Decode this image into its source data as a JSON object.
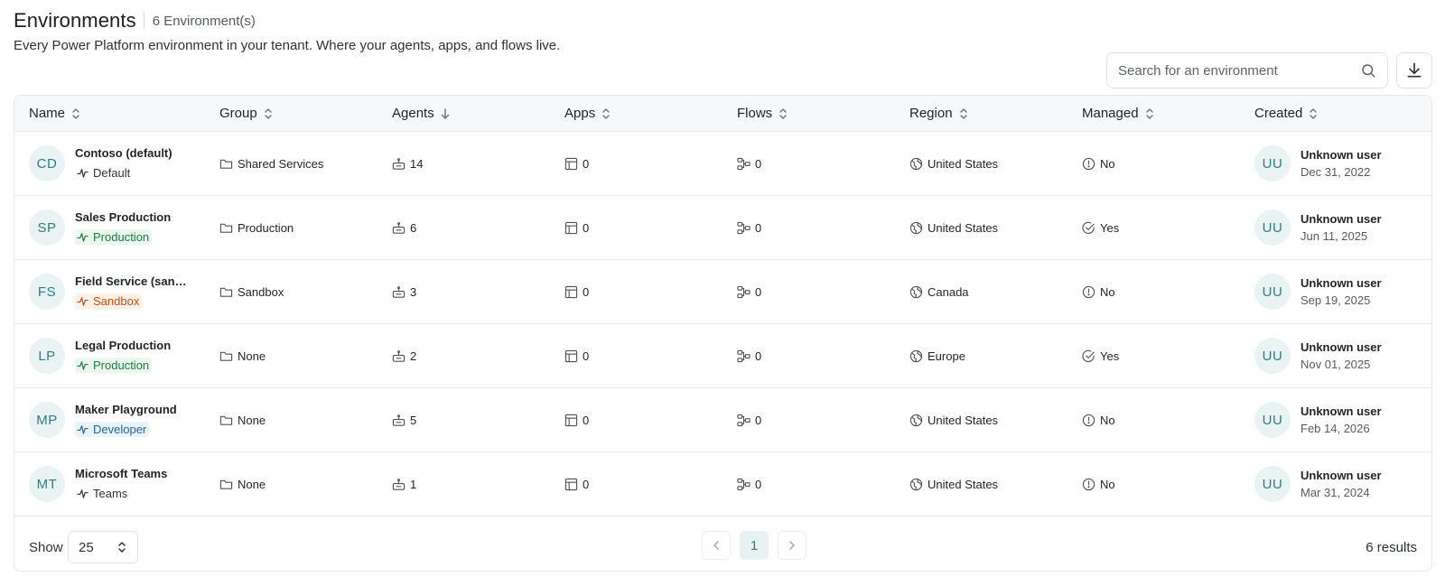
{
  "header": {
    "title": "Environments",
    "count": "6 Environment(s)",
    "subtitle": "Every Power Platform environment in your tenant. Where your agents, apps, and flows live."
  },
  "search": {
    "placeholder": "Search for an environment",
    "value": ""
  },
  "columns": [
    "Name",
    "Group",
    "Agents",
    "Apps",
    "Flows",
    "Region",
    "Managed",
    "Created"
  ],
  "rows": [
    {
      "initials": "CD",
      "name": "Contoso (default)",
      "type": "Default",
      "type_key": "default",
      "group": "Shared Services",
      "agents": "14",
      "apps": "0",
      "flows": "0",
      "region": "United States",
      "managed": "No",
      "creator_initials": "UU",
      "creator": "Unknown user",
      "created": "Dec 31, 2022"
    },
    {
      "initials": "SP",
      "name": "Sales Production",
      "type": "Production",
      "type_key": "production",
      "group": "Production",
      "agents": "6",
      "apps": "0",
      "flows": "0",
      "region": "United States",
      "managed": "Yes",
      "creator_initials": "UU",
      "creator": "Unknown user",
      "created": "Jun 11, 2025"
    },
    {
      "initials": "FS",
      "name": "Field Service (sandbox)",
      "type": "Sandbox",
      "type_key": "sandbox",
      "group": "Sandbox",
      "agents": "3",
      "apps": "0",
      "flows": "0",
      "region": "Canada",
      "managed": "No",
      "creator_initials": "UU",
      "creator": "Unknown user",
      "created": "Sep 19, 2025"
    },
    {
      "initials": "LP",
      "name": "Legal Production",
      "type": "Production",
      "type_key": "production",
      "group": "None",
      "agents": "2",
      "apps": "0",
      "flows": "0",
      "region": "Europe",
      "managed": "Yes",
      "creator_initials": "UU",
      "creator": "Unknown user",
      "created": "Nov 01, 2025"
    },
    {
      "initials": "MP",
      "name": "Maker Playground",
      "type": "Developer",
      "type_key": "developer",
      "group": "None",
      "agents": "5",
      "apps": "0",
      "flows": "0",
      "region": "United States",
      "managed": "No",
      "creator_initials": "UU",
      "creator": "Unknown user",
      "created": "Feb 14, 2026"
    },
    {
      "initials": "MT",
      "name": "Microsoft Teams",
      "type": "Teams",
      "type_key": "teams",
      "group": "None",
      "agents": "1",
      "apps": "0",
      "flows": "0",
      "region": "United States",
      "managed": "No",
      "creator_initials": "UU",
      "creator": "Unknown user",
      "created": "Mar 31, 2024"
    }
  ],
  "footer": {
    "show_label": "Show",
    "page_size": "25",
    "current_page": "1",
    "results": "6 results"
  },
  "icons": {
    "sort": "sort-icon",
    "sort_desc": "arrow-down-icon",
    "group": "folder-icon",
    "agents": "robot-icon",
    "apps": "app-window-icon",
    "flows": "flow-icon",
    "region": "globe-icon",
    "managed_no": "info-circle-icon",
    "managed_yes": "check-circle-icon"
  },
  "colors": {
    "avatar_bg": "#e9f3f3",
    "avatar_text": "#2f7f82",
    "production": "#17803d",
    "sandbox": "#c4510b",
    "developer": "#1c6a8e"
  }
}
